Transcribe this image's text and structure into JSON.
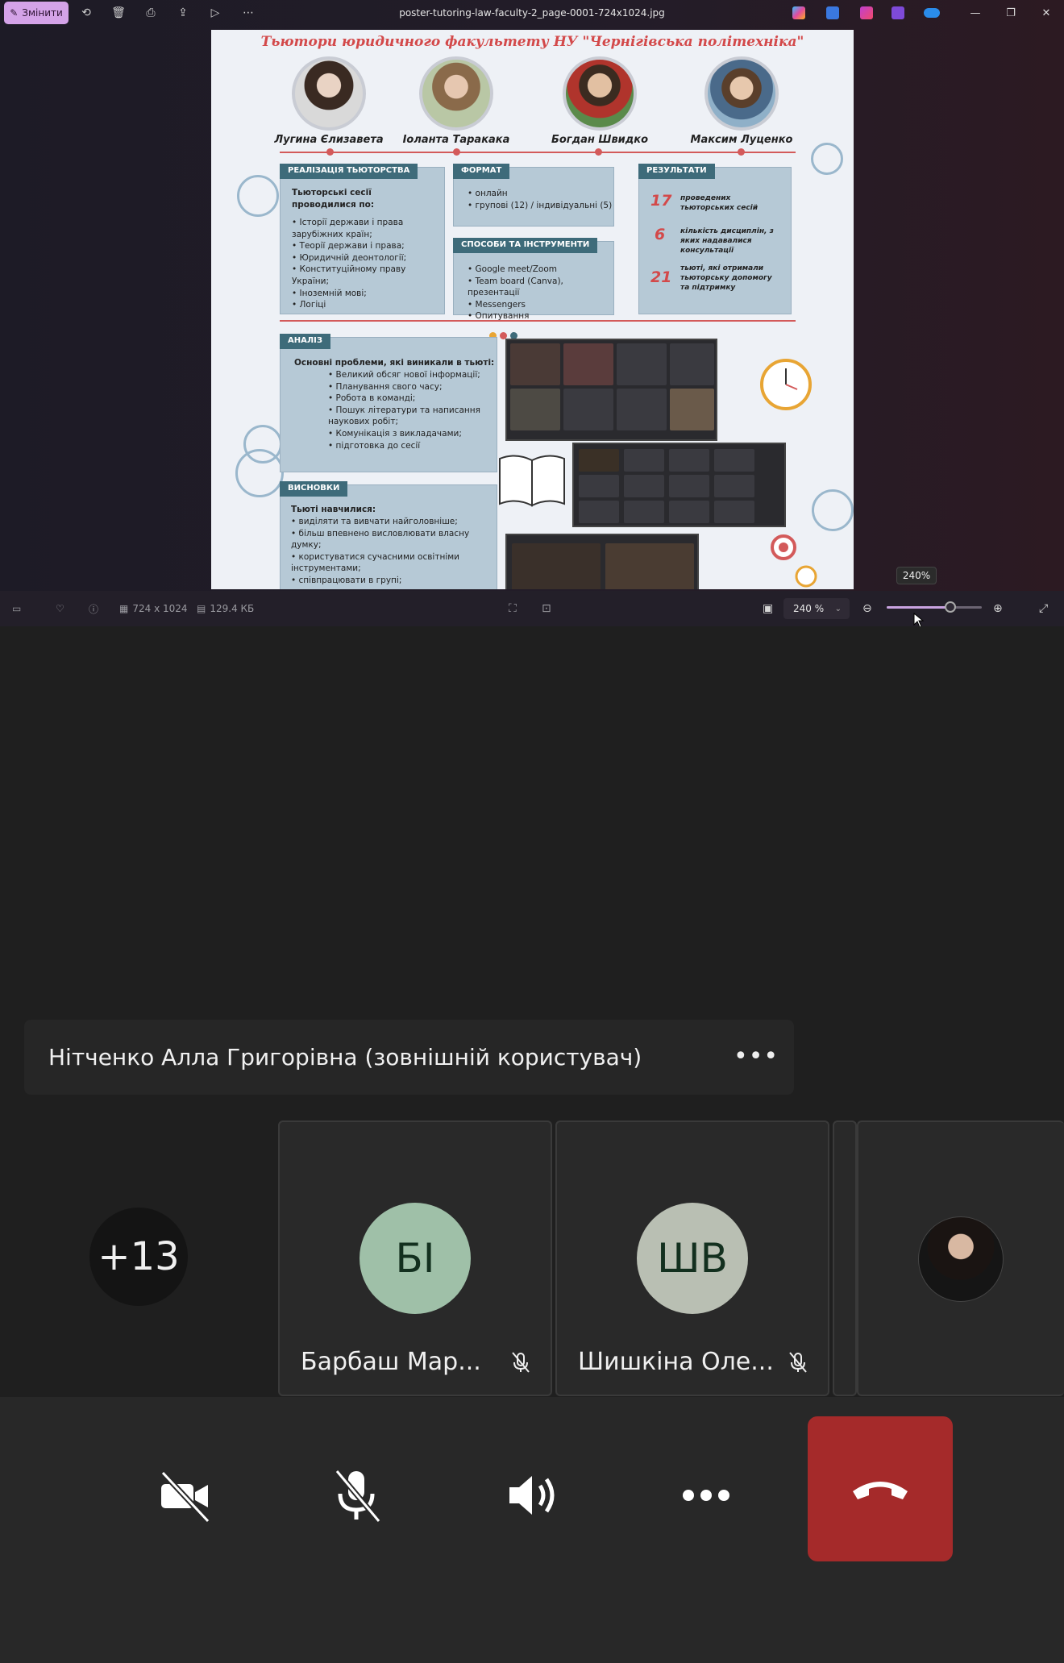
{
  "viewer": {
    "edit_label": "Змінити",
    "file_title": "poster-tutoring-law-faculty-2_page-0001-724x1024.jpg",
    "dimensions": "724 x 1024",
    "file_size": "129.4 КБ",
    "zoom_value": "240 %",
    "zoom_tooltip": "240%",
    "zoom_level_percent": 240
  },
  "poster": {
    "title": "Тьютори юридичного факультету НУ \"Чернігівська політехніка\"",
    "people": [
      "Лугина Єлизавета",
      "Іоланта Таракака",
      "Богдан Швидко",
      "Максим Луценко"
    ],
    "realization": {
      "heading": "РЕАЛІЗАЦІЯ ТЬЮТОРСТВА",
      "intro": "Тьюторські сесії проводилися по:",
      "items": [
        "Історії держави і права зарубіжних країн;",
        "Теорії держави і права;",
        "Юридичній деонтології;",
        "Конституційному праву України;",
        "Іноземній мові;",
        "Логіці"
      ]
    },
    "format": {
      "heading": "ФОРМАТ",
      "items": [
        "онлайн",
        "групові (12) / індивідуальні (5)"
      ]
    },
    "tools": {
      "heading": "СПОСОБИ ТА ІНСТРУМЕНТИ",
      "items": [
        "Google meet/Zoom",
        "Team board (Canva), презентації",
        "Messengers",
        "Опитування"
      ]
    },
    "results": {
      "heading": "РЕЗУЛЬТАТИ",
      "rows": [
        {
          "num": "17",
          "text": "проведених тьюторських сесій"
        },
        {
          "num": "6",
          "text": "кількість дисциплін, з яких надавалися консультації"
        },
        {
          "num": "21",
          "text": "тьюті, які отримали тьюторську допомогу та підтримку"
        }
      ]
    },
    "analysis": {
      "heading": "АНАЛІЗ",
      "intro": "Основні проблеми, які виникали в тьюті:",
      "items": [
        "Великий обсяг нової інформації;",
        "Планування свого часу;",
        "Робота в команді;",
        "Пошук літератури та написання наукових робіт;",
        "Комунікація з викладачами;",
        "підготовка до сесії"
      ]
    },
    "conclusions": {
      "heading": "ВИСНОВКИ",
      "intro": "Тьюті навчилися:",
      "items": [
        "виділяти та вивчати найголовніше;",
        "більш впевнено висловлювати власну думку;",
        "користуватися сучасними освітніми інструментами;",
        "співпрацювати в групі;"
      ]
    }
  },
  "meeting": {
    "presenter_name": "Нітченко Алла Григорівна (зовнішній користувач)",
    "overflow_count": "+13",
    "participants": [
      {
        "initials": "БІ",
        "name": "Барбаш Мар...",
        "muted": true,
        "avatar_color": "#9fc0a8"
      },
      {
        "initials": "ШВ",
        "name": "Шишкіна Оле...",
        "muted": true,
        "avatar_color": "#b9bfb3"
      }
    ],
    "controls": [
      "camera-off",
      "mic-off",
      "speaker",
      "more",
      "hang-up"
    ],
    "hangup_color": "#a52a2a"
  }
}
